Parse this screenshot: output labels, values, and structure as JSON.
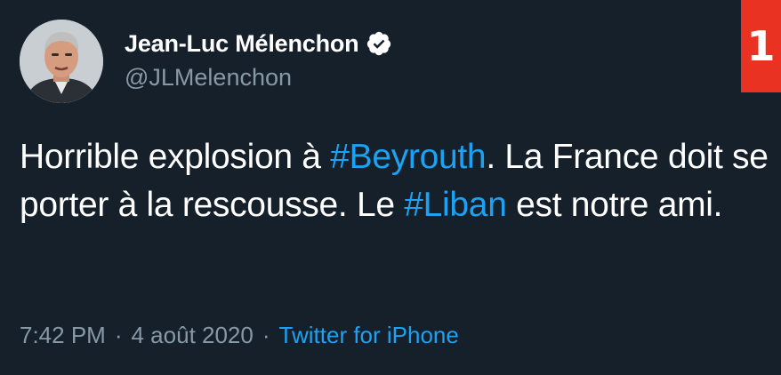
{
  "author": {
    "display_name": "Jean-Luc Mélenchon",
    "handle": "@JLMelenchon",
    "verified": true
  },
  "rank_badge": "1",
  "tweet": {
    "segments": [
      {
        "text": "Horrible explosion à ",
        "type": "text"
      },
      {
        "text": "#Beyrouth",
        "type": "hashtag"
      },
      {
        "text": ". La France doit se porter à la rescousse. Le ",
        "type": "text"
      },
      {
        "text": "#Liban",
        "type": "hashtag"
      },
      {
        "text": " est notre ami.",
        "type": "text"
      }
    ]
  },
  "meta": {
    "time": "7:42 PM",
    "separator_1": "·",
    "date": "4 août 2020",
    "separator_2": "·",
    "source": "Twitter for iPhone"
  },
  "colors": {
    "background": "#15202b",
    "text": "#ffffff",
    "secondary": "#8899a6",
    "link": "#1da1f2",
    "badge": "#ea3223"
  },
  "icons": {
    "verified": "verified-badge-icon",
    "avatar": "profile-photo"
  }
}
